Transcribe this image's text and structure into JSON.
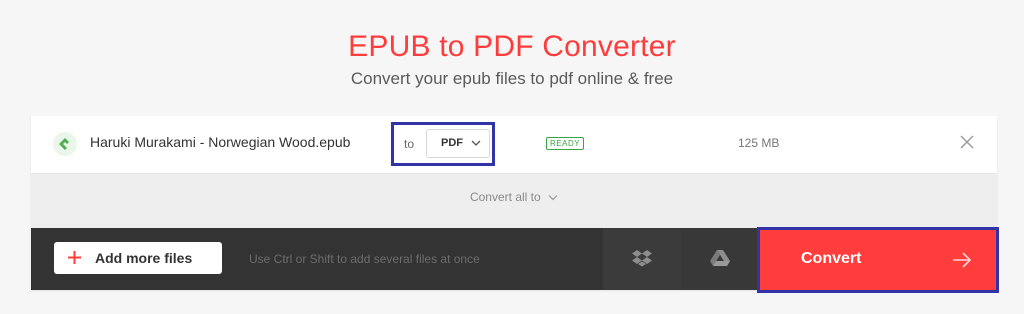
{
  "header": {
    "title": "EPUB to PDF Converter",
    "subtitle": "Convert your epub files to pdf online & free"
  },
  "file": {
    "name": "Haruki Murakami - Norwegian Wood.epub",
    "to_label": "to",
    "format": "PDF",
    "status": "READY",
    "size": "125 MB",
    "icon": "epub-file-icon"
  },
  "convert_all": {
    "label": "Convert all to"
  },
  "toolbar": {
    "add_files_label": "Add more files",
    "hint": "Use Ctrl or Shift to add several files at once",
    "convert_label": "Convert",
    "dropbox_icon": "dropbox-icon",
    "drive_icon": "google-drive-icon"
  },
  "colors": {
    "accent": "#ff3c3c",
    "ready": "#37a345",
    "bar": "#333333",
    "highlight": "#3333a8"
  }
}
